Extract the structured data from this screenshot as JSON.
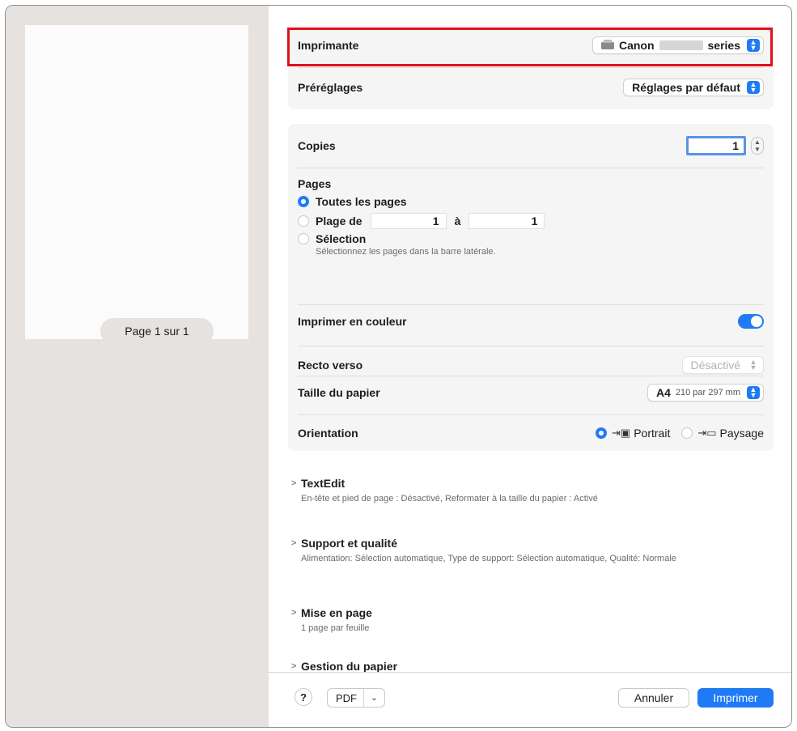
{
  "preview": {
    "page_indicator": "Page 1 sur 1"
  },
  "printer": {
    "label": "Imprimante",
    "value_prefix": "Canon",
    "value_suffix": "series"
  },
  "presets": {
    "label": "Préréglages",
    "value": "Réglages par défaut"
  },
  "copies": {
    "label": "Copies",
    "value": "1"
  },
  "pages": {
    "label": "Pages",
    "all": "Toutes les pages",
    "range_label": "Plage de",
    "range_from": "1",
    "range_to_label": "à",
    "range_to": "1",
    "selection": "Sélection",
    "selection_hint": "Sélectionnez les pages dans la barre latérale."
  },
  "color": {
    "label": "Imprimer en couleur",
    "enabled": true
  },
  "duplex": {
    "label": "Recto verso",
    "value": "Désactivé"
  },
  "paper_size": {
    "label": "Taille du papier",
    "value_main": "A4",
    "value_detail": "210 par 297 mm"
  },
  "orientation": {
    "label": "Orientation",
    "portrait": "Portrait",
    "landscape": "Paysage",
    "selected": "Portrait"
  },
  "sections": [
    {
      "title": "TextEdit",
      "summary": "En-tête et pied de page : Désactivé, Reformater à la taille du papier : Activé"
    },
    {
      "title": "Support et qualité",
      "summary": "Alimentation: Sélection automatique, Type de support: Sélection automatique, Qualité: Normale"
    },
    {
      "title": "Mise en page",
      "summary": "1 page par feuille"
    },
    {
      "title": "Gestion du papier",
      "summary": ""
    }
  ],
  "footer": {
    "help": "?",
    "pdf": "PDF",
    "cancel": "Annuler",
    "print": "Imprimer"
  },
  "colors": {
    "accent": "#1f7bf4",
    "highlight": "#e0101c",
    "sidebar_bg": "#e6e2df"
  }
}
